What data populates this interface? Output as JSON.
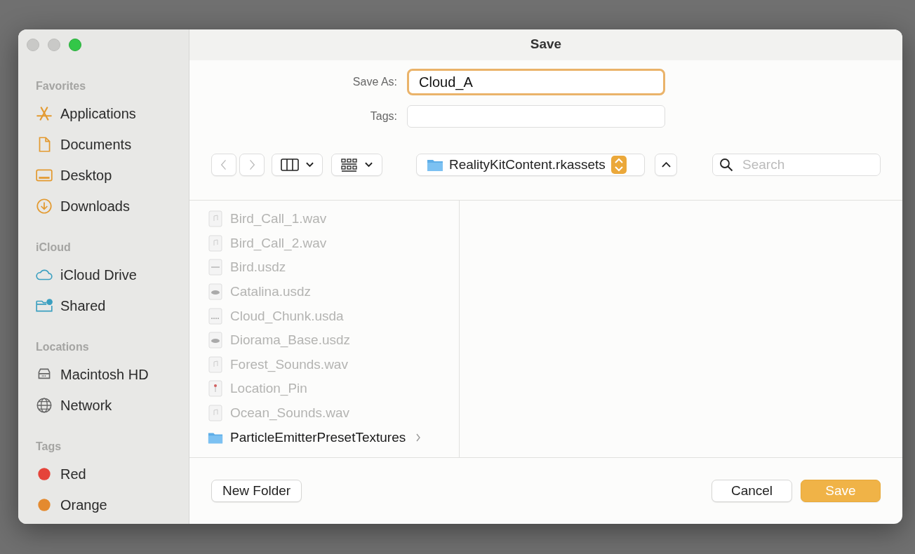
{
  "window": {
    "title": "Save"
  },
  "sidebar": {
    "sections": [
      {
        "heading": "Favorites",
        "items": [
          {
            "label": "Applications",
            "kind": "apps"
          },
          {
            "label": "Documents",
            "kind": "document"
          },
          {
            "label": "Desktop",
            "kind": "desktop"
          },
          {
            "label": "Downloads",
            "kind": "download"
          }
        ]
      },
      {
        "heading": "iCloud",
        "items": [
          {
            "label": "iCloud Drive",
            "kind": "cloud"
          },
          {
            "label": "Shared",
            "kind": "shared"
          }
        ]
      },
      {
        "heading": "Locations",
        "items": [
          {
            "label": "Macintosh HD",
            "kind": "disk"
          },
          {
            "label": "Network",
            "kind": "globe"
          }
        ]
      },
      {
        "heading": "Tags",
        "items": [
          {
            "label": "Red",
            "kind": "tag",
            "color": "#e5443a"
          },
          {
            "label": "Orange",
            "kind": "tag",
            "color": "#e48a2f"
          }
        ]
      }
    ]
  },
  "save_as": {
    "label": "Save As:",
    "value": "Cloud_A"
  },
  "tags": {
    "label": "Tags:"
  },
  "location": {
    "label": "RealityKitContent.rkassets"
  },
  "search": {
    "placeholder": "Search"
  },
  "files": [
    {
      "name": "Bird_Call_1.wav",
      "kind": "audio",
      "disabled": true
    },
    {
      "name": "Bird_Call_2.wav",
      "kind": "audio",
      "disabled": true
    },
    {
      "name": "Bird.usdz",
      "kind": "bird",
      "disabled": true
    },
    {
      "name": "Catalina.usdz",
      "kind": "model",
      "disabled": true
    },
    {
      "name": "Cloud_Chunk.usda",
      "kind": "usda",
      "disabled": true
    },
    {
      "name": "Diorama_Base.usdz",
      "kind": "model",
      "disabled": true
    },
    {
      "name": "Forest_Sounds.wav",
      "kind": "audio",
      "disabled": true
    },
    {
      "name": "Location_Pin",
      "kind": "pin",
      "disabled": true
    },
    {
      "name": "Ocean_Sounds.wav",
      "kind": "audio",
      "disabled": true
    },
    {
      "name": "ParticleEmitterPresetTextures",
      "kind": "folder",
      "disabled": false
    }
  ],
  "buttons": {
    "new_folder": "New Folder",
    "cancel": "Cancel",
    "save": "Save"
  }
}
